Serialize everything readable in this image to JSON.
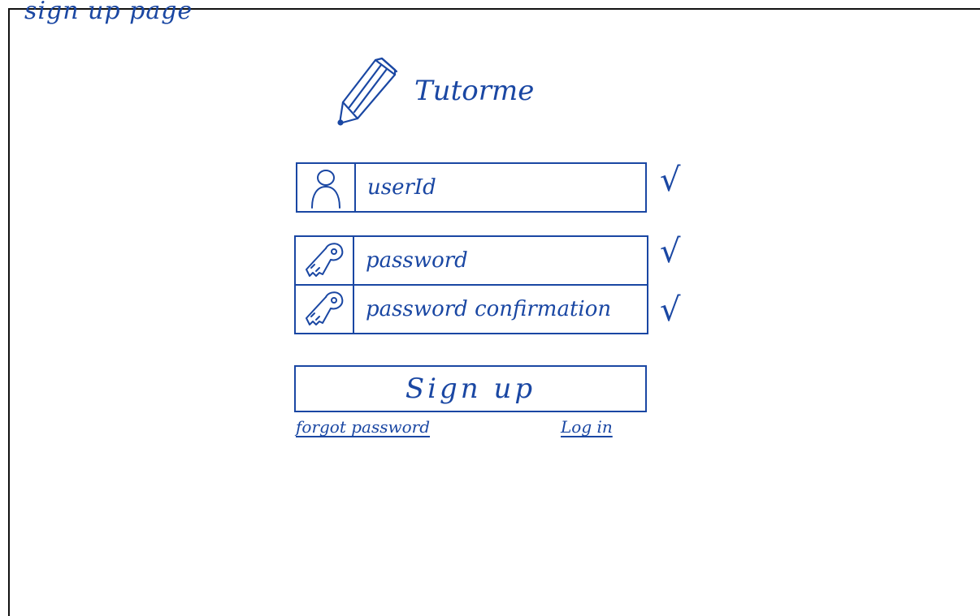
{
  "page": {
    "caption": "sign up page"
  },
  "brand": {
    "name": "Tutorme",
    "icon": "pencil-icon"
  },
  "form": {
    "userid": {
      "placeholder": "userId",
      "icon": "user-icon",
      "valid_mark": "√"
    },
    "password": {
      "placeholder": "password",
      "icon": "key-icon",
      "valid_mark": "√"
    },
    "password_confirmation": {
      "placeholder": "password confirmation",
      "icon": "key-icon",
      "valid_mark": "√"
    },
    "submit_label": "Sign up"
  },
  "links": {
    "forgot_password": "forgot password",
    "login": "Log in"
  },
  "colors": {
    "ink": "#1a47a3",
    "frame": "#111111",
    "background": "#ffffff"
  }
}
